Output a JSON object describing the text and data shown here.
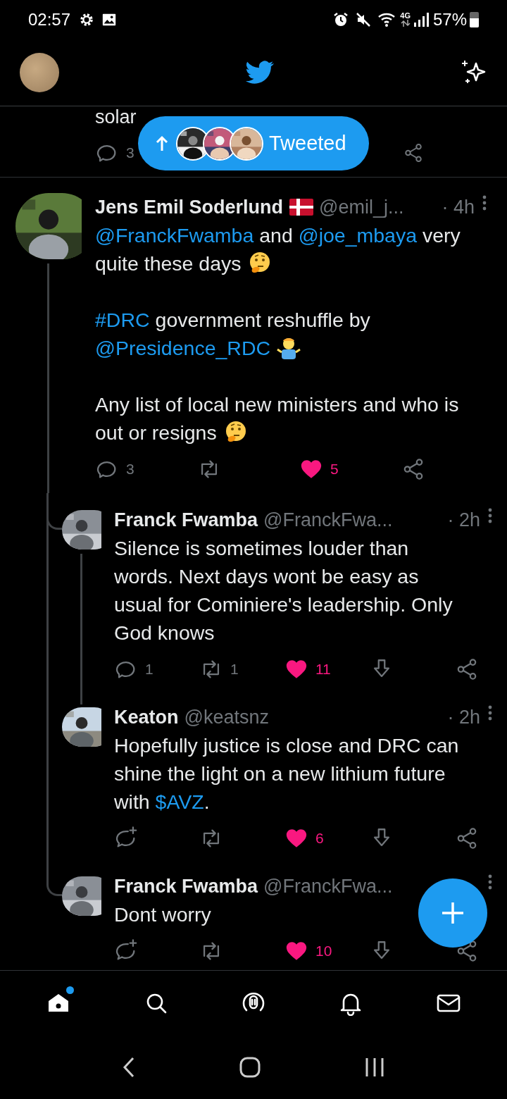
{
  "status_bar": {
    "time": "02:57",
    "network": "4G",
    "battery": "57%"
  },
  "tweeted_pill": {
    "label": "Tweeted"
  },
  "partial_tweet": {
    "text": "solar",
    "reply_count": "3"
  },
  "thread": {
    "name": "Jens Emil Soderlund",
    "flag": true,
    "handle": "@emil_j...",
    "time": "· 4h",
    "body": [
      [
        {
          "kind": "link",
          "text": "@FranckFwamba"
        },
        {
          "kind": "text",
          "text": " and "
        },
        {
          "kind": "link",
          "text": "@joe_mbaya"
        },
        {
          "kind": "text",
          "text": " very quite these days "
        },
        {
          "kind": "thinking"
        }
      ],
      [
        {
          "kind": "link",
          "text": "#DRC"
        },
        {
          "kind": "text",
          "text": " government reshuffle by "
        },
        {
          "kind": "link",
          "text": "@Presidence_RDC"
        },
        {
          "kind": "shrug"
        }
      ],
      [
        {
          "kind": "text",
          "text": "Any list of local new ministers and who is out or resigns "
        },
        {
          "kind": "thinking"
        }
      ]
    ],
    "actions": [
      {
        "kind": "reply",
        "count": "3"
      },
      {
        "kind": "retweet"
      },
      {
        "kind": "like",
        "on": true,
        "count": "5"
      },
      {
        "kind": "share"
      }
    ],
    "children": [
      {
        "name": "Franck Fwamba",
        "handle": "@FranckFwa...",
        "time": "· 2h",
        "body": [
          [
            {
              "kind": "text",
              "text": "Silence is sometimes louder than words. Next days wont be easy as usual for Cominiere's leadership. Only God knows"
            }
          ]
        ],
        "actions": [
          {
            "kind": "reply",
            "count": "1"
          },
          {
            "kind": "retweet",
            "count": "1"
          },
          {
            "kind": "like",
            "on": true,
            "count": "11"
          },
          {
            "kind": "download"
          },
          {
            "kind": "share"
          }
        ],
        "children": [
          {
            "name": "Keaton",
            "handle": "@keatsnz",
            "time": "· 2h",
            "body": [
              [
                {
                  "kind": "text",
                  "text": "Hopefully justice is close and DRC can shine the light on a new lithium future with "
                },
                {
                  "kind": "link",
                  "text": "$AVZ"
                },
                {
                  "kind": "text",
                  "text": "."
                }
              ]
            ],
            "actions": [
              {
                "kind": "reply-plus"
              },
              {
                "kind": "retweet"
              },
              {
                "kind": "like",
                "on": true,
                "count": "6"
              },
              {
                "kind": "download"
              },
              {
                "kind": "share"
              }
            ]
          }
        ]
      },
      {
        "name": "Franck Fwamba",
        "handle": "@FranckFwa...",
        "body": [
          [
            {
              "kind": "text",
              "text": "Dont worry"
            }
          ]
        ],
        "actions": [
          {
            "kind": "reply-plus"
          },
          {
            "kind": "retweet"
          },
          {
            "kind": "like",
            "on": true,
            "count": "10"
          },
          {
            "kind": "download"
          },
          {
            "kind": "share"
          }
        ]
      }
    ]
  },
  "bottom_nav": [
    {
      "kind": "home",
      "selected": true,
      "badge": true
    },
    {
      "kind": "search",
      "selected": false
    },
    {
      "kind": "spaces",
      "selected": false
    },
    {
      "kind": "notifications",
      "selected": false
    },
    {
      "kind": "messages",
      "selected": false
    }
  ]
}
